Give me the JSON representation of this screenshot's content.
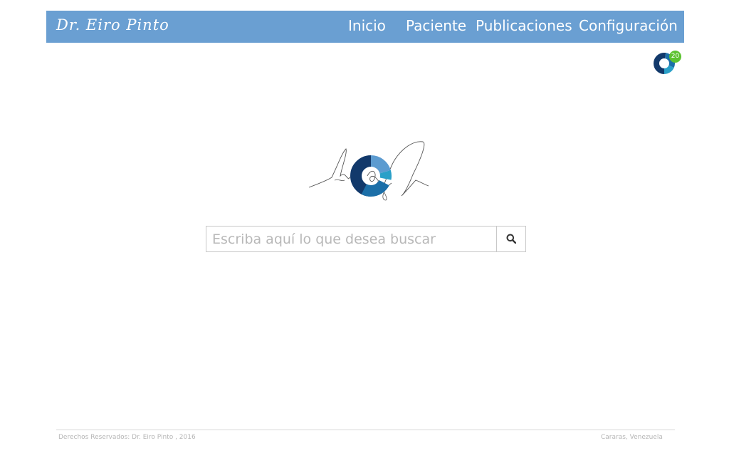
{
  "brand": {
    "name": "Dr. Eiro Pinto"
  },
  "nav": {
    "items": [
      {
        "label": "Inicio"
      },
      {
        "label": "Paciente"
      },
      {
        "label": "Publicaciones"
      },
      {
        "label": "Configuración"
      }
    ]
  },
  "notifications": {
    "count": "20",
    "icon": "donut-chart-icon",
    "badge_color": "#5cc230"
  },
  "search": {
    "placeholder": "Escriba aquí lo que desea buscar",
    "value": "",
    "button_icon": "search-icon"
  },
  "footer": {
    "copyright": "Derechos Reservados: Dr. Eiro Pinto , 2016",
    "location": "Cararas, Venezuela"
  },
  "colors": {
    "navbar": "#6a9fd2",
    "logo_dark": "#12396b",
    "logo_mid": "#1c6fa8",
    "logo_light": "#5c9bd0",
    "logo_cyan": "#2aa0c8"
  }
}
